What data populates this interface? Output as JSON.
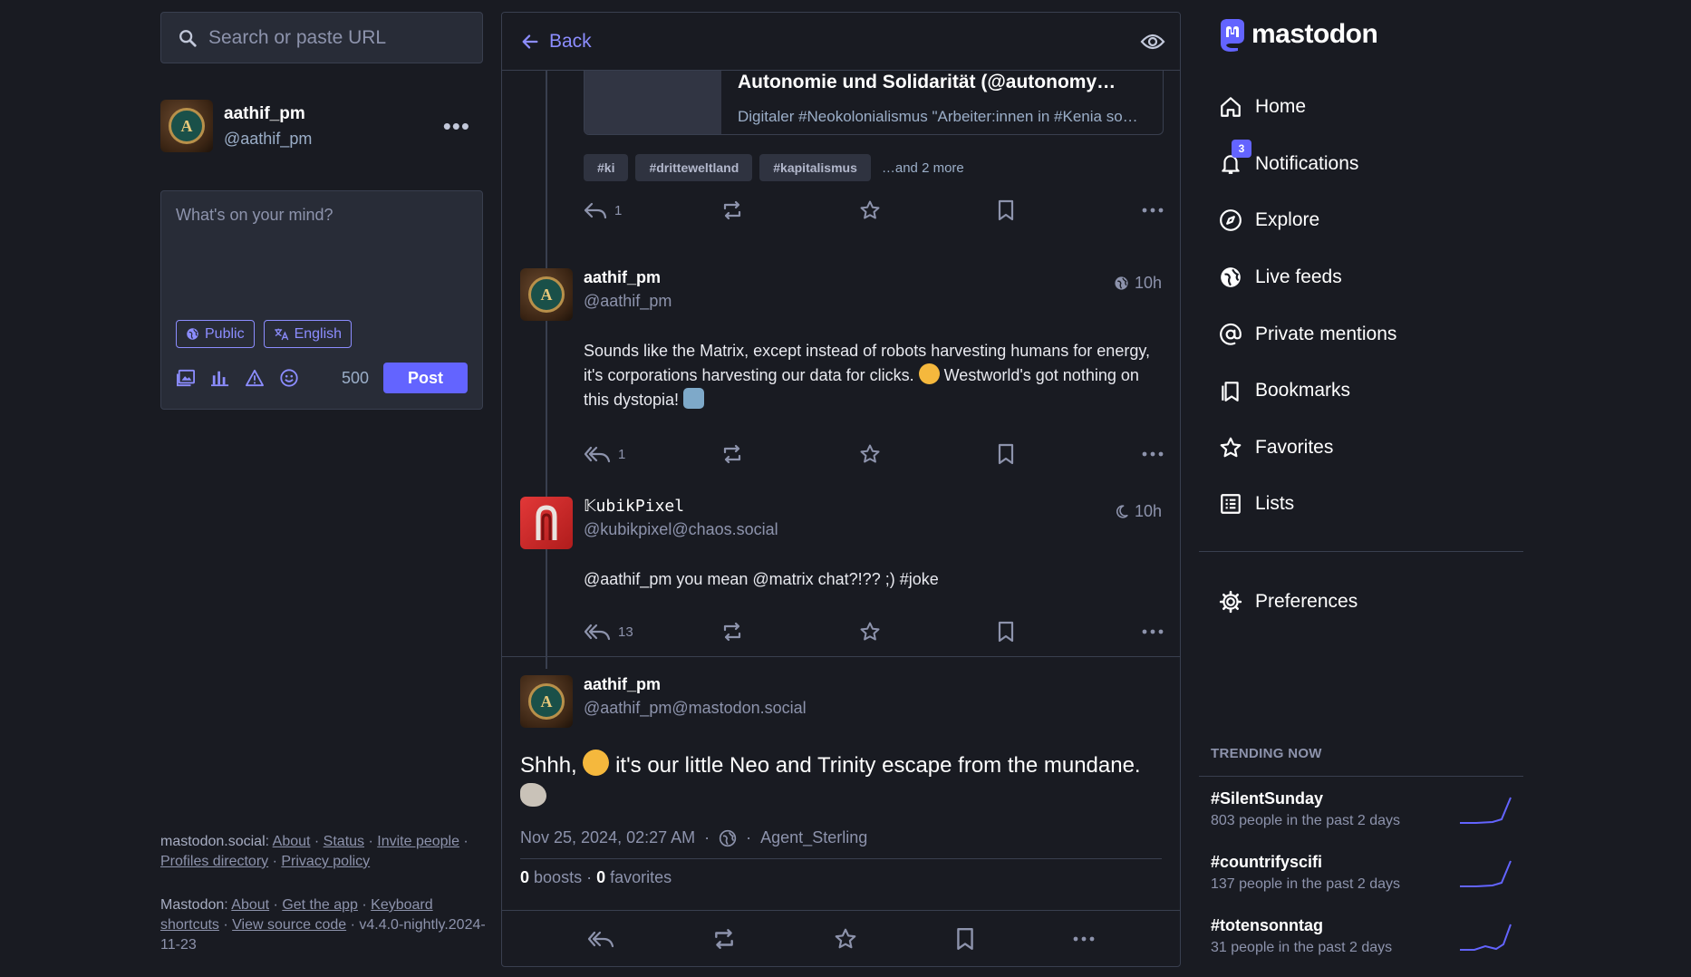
{
  "search": {
    "placeholder": "Search or paste URL"
  },
  "account": {
    "display_name": "aathif_pm",
    "handle": "@aathif_pm",
    "menu": "•••",
    "avatar_letter": "A"
  },
  "compose": {
    "placeholder": "What's on your mind?",
    "visibility": "Public",
    "language": "English",
    "char_count": "500",
    "post_label": "Post"
  },
  "footer": {
    "instance": "mastodon.social",
    "about": "About",
    "status": "Status",
    "invite": "Invite people",
    "profiles": "Profiles directory",
    "privacy": "Privacy policy",
    "mastodon": "Mastodon",
    "about2": "About",
    "get_app": "Get the app",
    "shortcuts": "Keyboard shortcuts",
    "source": "View source code",
    "version": "v4.4.0-nightly.2024-11-23"
  },
  "header": {
    "back_label": "Back"
  },
  "card": {
    "title": "Autonomie und Solidarität (@autonomy…",
    "description": "Digitaler #Neokolonialismus \"Arbeiter:innen in #Kenia so…"
  },
  "hashtags": [
    "#ki",
    "#dritteweltland",
    "#kapitalismus"
  ],
  "hashtags_more": "…and 2 more",
  "post0_actions": {
    "reply_count": "1"
  },
  "post1": {
    "display_name": "aathif_pm",
    "handle": "@aathif_pm",
    "time": "10h",
    "text_a": "Sounds like the Matrix, except instead of robots harvesting humans for energy, it's corporations harvesting our data for clicks.",
    "text_b": "Westworld's got nothing on this dystopia!",
    "reply_count": "1"
  },
  "post2": {
    "display_name": "𝕂ubikPixel",
    "handle": "@kubikpixel@chaos.social",
    "time": "10h",
    "text": "@aathif_pm you mean @matrix chat?!?? ;) #joke",
    "reply_count": "13"
  },
  "focused": {
    "display_name": "aathif_pm",
    "handle": "@aathif_pm@mastodon.social",
    "text_a": "Shhh,",
    "text_b": "it's our little Neo and Trinity escape from the mundane.",
    "date": "Nov 25, 2024, 02:27 AM",
    "app": "Agent_Sterling",
    "boosts": "0",
    "boosts_label": "boosts",
    "favorites": "0",
    "favorites_label": "favorites"
  },
  "logo": {
    "text": "mastodon"
  },
  "nav": {
    "home": "Home",
    "notifications": "Notifications",
    "notifications_badge": "3",
    "explore": "Explore",
    "live": "Live feeds",
    "mentions": "Private mentions",
    "bookmarks": "Bookmarks",
    "favorites": "Favorites",
    "lists": "Lists",
    "preferences": "Preferences"
  },
  "trending": {
    "title": "TRENDING NOW",
    "items": [
      {
        "name": "#SilentSunday",
        "sub": "803 people in the past 2 days"
      },
      {
        "name": "#countrifyscifi",
        "sub": "137 people in the past 2 days"
      },
      {
        "name": "#totensonntag",
        "sub": "31 people in the past 2 days"
      }
    ]
  },
  "colors": {
    "accent": "#6364ff",
    "accent_light": "#8c8dff",
    "bg": "#191b22",
    "panel": "#282c37",
    "border": "#393f4f"
  }
}
